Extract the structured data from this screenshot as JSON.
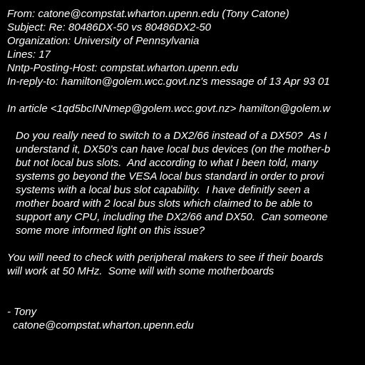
{
  "headers": {
    "from": "From: catone@compstat.wharton.upenn.edu (Tony Catone)",
    "subject": "Subject: Re: 80486DX-50 vs 80486DX2-50",
    "organization": "Organization: University of Pennsylvania",
    "lines": "Lines: 17",
    "nntp_host": "Nntp-Posting-Host: compstat.wharton.upenn.edu",
    "in_reply_to": "In-reply-to: hamilton@golem.wcc.govt.nz's message of 13 Apr 93 01"
  },
  "attribution": "In article <1qd5bcINNmep@golem.wcc.govt.nz> hamilton@golem.w",
  "quoted": [
    "Do you really need to switch to a DX2/66 instead of a DX50?  As I",
    "understand it, DX50's can have local bus devices (on the mother-b",
    "but not local bus slots.  And according to what I been told, many",
    "systems go beyond the VESA local bus standard in order to provi",
    "systems with a local bus slot capability.  I have definitly seen a",
    "mother board with 2 local bus slots which claimed to be able to",
    "support any CPU, including the DX2/66 and DX50.  Can someone",
    "some more informed light on this issue?"
  ],
  "reply": [
    "You will need to check with peripheral makers to see if their boards",
    "will work at 50 MHz.  Some will with some motherboards"
  ],
  "signature": {
    "name": "- Tony",
    "email": "catone@compstat.wharton.upenn.edu"
  },
  "colors": {
    "background": "#000000",
    "text": "#ffffff"
  }
}
